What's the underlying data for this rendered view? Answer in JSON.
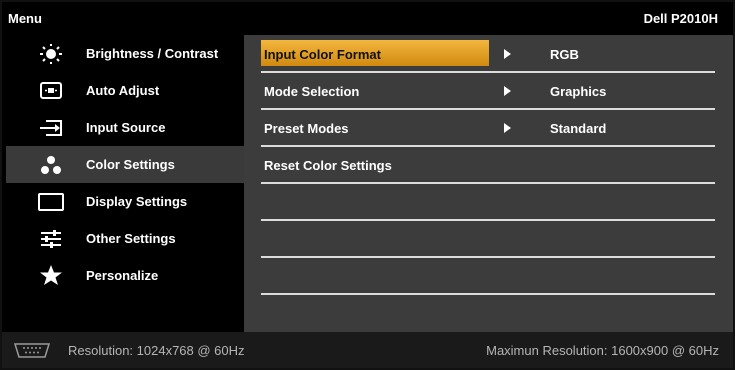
{
  "header": {
    "title": "Menu",
    "model": "Dell P2010H"
  },
  "sidebar": {
    "items": [
      {
        "label": "Brightness / Contrast",
        "icon": "brightness-icon"
      },
      {
        "label": "Auto Adjust",
        "icon": "auto-adjust-icon"
      },
      {
        "label": "Input Source",
        "icon": "input-source-icon"
      },
      {
        "label": "Color Settings",
        "icon": "color-settings-icon",
        "selected": true
      },
      {
        "label": "Display Settings",
        "icon": "display-settings-icon"
      },
      {
        "label": "Other Settings",
        "icon": "other-settings-icon"
      },
      {
        "label": "Personalize",
        "icon": "star-icon"
      }
    ]
  },
  "panel": {
    "rows": [
      {
        "label": "Input Color Format",
        "value": "RGB",
        "selected": true
      },
      {
        "label": "Mode Selection",
        "value": "Graphics"
      },
      {
        "label": "Preset Modes",
        "value": "Standard"
      },
      {
        "label": "Reset Color Settings",
        "value": ""
      },
      {
        "label": "",
        "value": ""
      },
      {
        "label": "",
        "value": ""
      },
      {
        "label": "",
        "value": ""
      }
    ]
  },
  "status": {
    "connector_icon": "vga-icon",
    "resolution": "Resolution: 1024x768 @ 60Hz",
    "max_resolution": "Maximun Resolution: 1600x900 @ 60Hz"
  },
  "colors": {
    "highlight": "#e9a526",
    "panel": "#3c3c3c",
    "selected_item": "#3a3a3a"
  }
}
